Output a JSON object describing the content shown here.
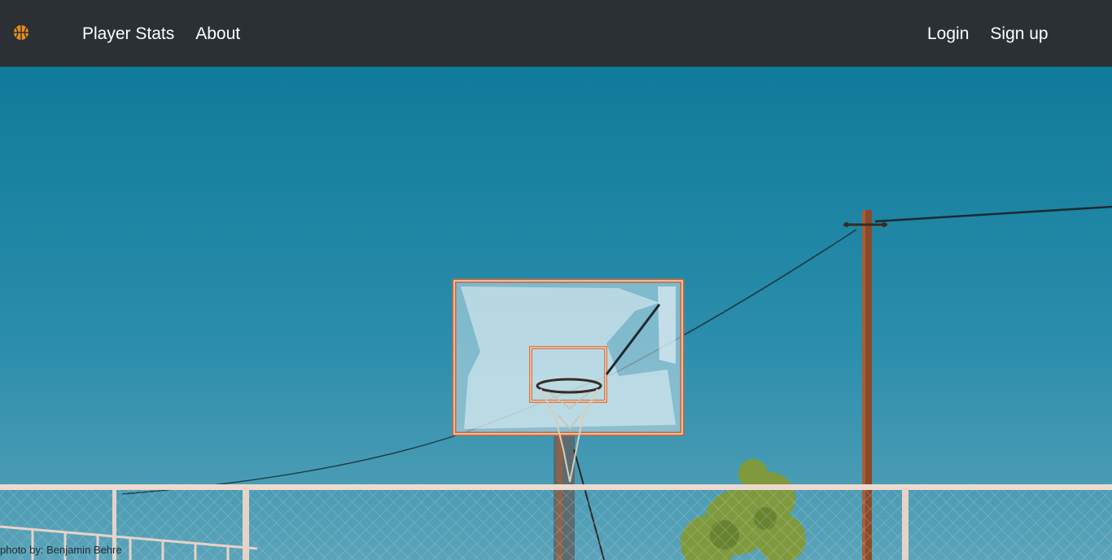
{
  "navbar": {
    "links_left": [
      {
        "label": "Player Stats"
      },
      {
        "label": "About"
      }
    ],
    "links_right": [
      {
        "label": "Login"
      },
      {
        "label": "Sign up"
      }
    ],
    "brand_icon": "basketball-icon",
    "brand_color": "#e98a1a",
    "background": "#2b3035"
  },
  "hero": {
    "image": "basketball-hoop-photo",
    "sky_color_top": "#0f7b9a",
    "sky_color_bottom": "#4b9bb5",
    "credit": "photo by: Benjamin Behre"
  }
}
